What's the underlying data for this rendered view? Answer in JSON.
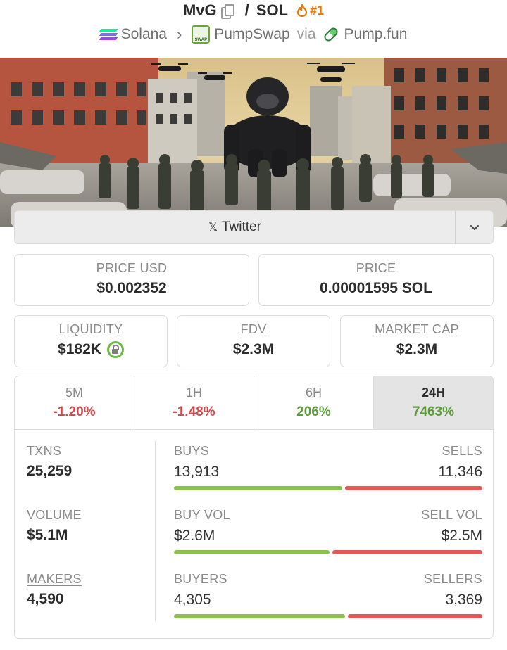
{
  "header": {
    "token": "MvG",
    "separator": "/",
    "quote": "SOL",
    "rank": "#1",
    "chain": "Solana",
    "dex": "PumpSwap",
    "via": "via",
    "platform": "Pump.fun"
  },
  "socials": {
    "twitter_label": "Twitter"
  },
  "price_usd": {
    "label": "PRICE USD",
    "value": "$0.002352"
  },
  "price": {
    "label": "PRICE",
    "value": "0.00001595 SOL"
  },
  "liquidity": {
    "label": "LIQUIDITY",
    "value": "$182K"
  },
  "fdv": {
    "label": "FDV",
    "value": "$2.3M"
  },
  "market_cap": {
    "label": "MARKET CAP",
    "value": "$2.3M"
  },
  "timeframes": [
    {
      "label": "5M",
      "change": "-1.20%"
    },
    {
      "label": "1H",
      "change": "-1.48%"
    },
    {
      "label": "6H",
      "change": "206%"
    },
    {
      "label": "24H",
      "change": "7463%"
    }
  ],
  "stats": {
    "txns": {
      "label": "TXNS",
      "value": "25,259"
    },
    "volume": {
      "label": "VOLUME",
      "value": "$5.1M"
    },
    "makers": {
      "label": "MAKERS",
      "value": "4,590"
    }
  },
  "ratios": {
    "buys": {
      "label": "BUYS",
      "value": "13,913",
      "buy_fraction": 0.551
    },
    "sells": {
      "label": "SELLS",
      "value": "11,346"
    },
    "buy_vol": {
      "label": "BUY VOL",
      "value": "$2.6M",
      "buy_fraction": 0.51
    },
    "sell_vol": {
      "label": "SELL VOL",
      "value": "$2.5M"
    },
    "buyers": {
      "label": "BUYERS",
      "value": "4,305",
      "buy_fraction": 0.561
    },
    "sellers": {
      "label": "SELLERS",
      "value": "3,369"
    }
  },
  "colors": {
    "positive": "#5d9a3a",
    "negative": "#d24a4a",
    "buy_bar": "#8cc04f",
    "sell_bar": "#e05a5a",
    "rank": "#e8760c"
  }
}
